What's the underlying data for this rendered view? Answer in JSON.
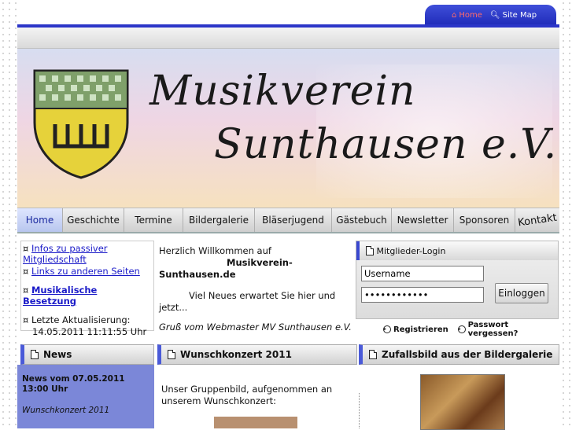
{
  "topnav": {
    "home": "Home",
    "sitemap": "Site Map"
  },
  "banner": {
    "title_line1": "Musikverein",
    "title_line2": "Sunthausen e.V."
  },
  "nav": {
    "items": [
      "Home",
      "Geschichte",
      "Termine",
      "Bildergalerie",
      "Bläserjugend",
      "Gästebuch",
      "Newsletter",
      "Sponsoren",
      "Kontakt"
    ],
    "active": "Home"
  },
  "left_info": {
    "link1": "Infos zu passiver Mitgliedschaft",
    "link2": "Links zu anderen Seiten",
    "link3": "Musikalische Besetzung",
    "last_update_label": "Letzte Aktualisierung:",
    "last_update_value": "14.05.2011 11:11:55 Uhr",
    "bullet": "¤"
  },
  "welcome": {
    "line1": "Herzlich Willkommen auf",
    "line2": "Musikverein-",
    "line3": "Sunthausen.de",
    "line4": "Viel Neues erwartet Sie hier und",
    "line5": "jetzt...",
    "signature": "Gruß vom Webmaster MV Sunthausen e.V."
  },
  "login": {
    "header": "Mitglieder-Login",
    "username_value": "Username",
    "password_value": "••••••••••••",
    "button": "Einloggen",
    "register": "Registrieren",
    "forgot": "Passwort vergessen?"
  },
  "sections": {
    "news": "News",
    "wunschkonzert": "Wunschkonzert 2011",
    "zufallsbild": "Zufallsbild aus der Bildergalerie"
  },
  "news": {
    "item_title": "News vom 07.05.2011 13:00 Uhr",
    "item_subtitle": "Wunschkonzert 2011"
  },
  "wunsch_text": {
    "line1": "Unser Gruppenbild, aufgenommen an",
    "line2": "unserem Wunschkonzert:"
  },
  "colors": {
    "accent": "#2b35c8",
    "news_bg": "#7b87d8",
    "link": "#1a1ac8"
  }
}
